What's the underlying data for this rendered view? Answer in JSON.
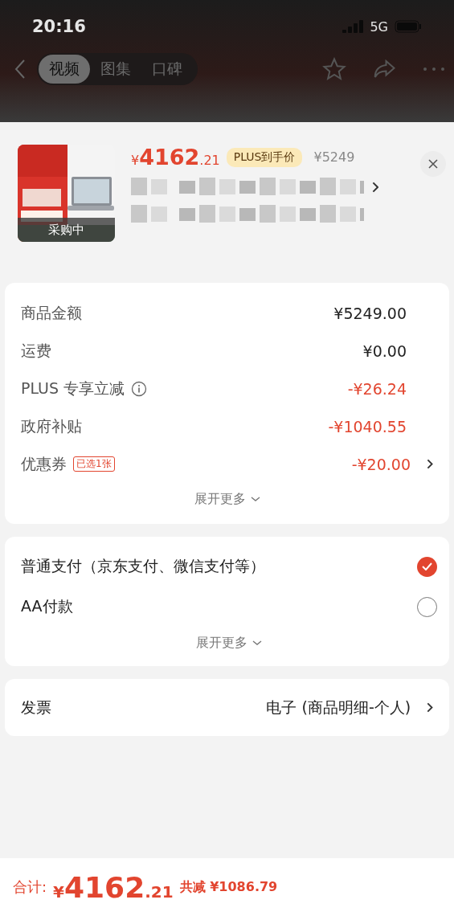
{
  "status_bar": {
    "time": "20:16",
    "network": "5G"
  },
  "nav": {
    "tabs": [
      {
        "label": "视频",
        "selected": true
      },
      {
        "label": "图集",
        "selected": false
      },
      {
        "label": "口碑",
        "selected": false
      }
    ]
  },
  "product": {
    "currency": "¥",
    "price": "4162",
    "cents": ".21",
    "badge": "PLUS到手价",
    "original_price": "¥5249",
    "image_status": "采购中"
  },
  "fees": {
    "rows": [
      {
        "label": "商品金额",
        "value": "¥5249.00",
        "discount": false
      },
      {
        "label": "运费",
        "value": "¥0.00",
        "discount": false
      },
      {
        "label": "PLUS 专享立减",
        "value": "-¥26.24",
        "discount": true,
        "info": true
      },
      {
        "label": "政府补贴",
        "value": "-¥1040.55",
        "discount": true
      },
      {
        "label": "优惠券",
        "value": "-¥20.00",
        "discount": true,
        "tag": "已选1张",
        "link": true
      }
    ],
    "more": "展开更多"
  },
  "payment": {
    "options": [
      {
        "label": "普通支付（京东支付、微信支付等）",
        "selected": true
      },
      {
        "label": "AA付款",
        "selected": false
      }
    ],
    "more": "展开更多"
  },
  "invoice": {
    "label": "发票",
    "value": "电子 (商品明细-个人)"
  },
  "footer": {
    "label": "合计:",
    "currency": "¥",
    "price": "4162",
    "cents": ".21",
    "saved_label": "共减",
    "saved": "¥1086.79"
  }
}
